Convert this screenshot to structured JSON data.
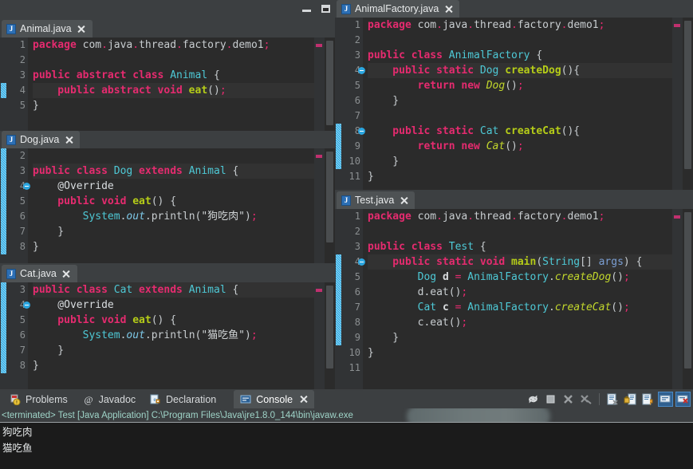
{
  "window": {
    "controls": [
      {
        "name": "minimize",
        "glyph": "minimize-icon"
      },
      {
        "name": "restore",
        "glyph": "restore-icon"
      }
    ]
  },
  "theme": {
    "editor_bg": "#2b2b2b",
    "panel_bg": "#3c3f41",
    "tab_active_bg": "#4e5254",
    "gutter_bg": "#313335",
    "keyword": "#e52b6f",
    "type": "#4ec9d6",
    "method_decl": "#b5cc18",
    "method_call": "#c3d82c",
    "plain": "#c8cdd0",
    "change_marker": "#2ba6e0",
    "console_text": "#e3e6e7",
    "console_info": "#9fd4c8"
  },
  "editors": [
    {
      "id": "animal",
      "tab": {
        "label": "Animal.java",
        "icon": "java-file-icon",
        "close": "close-icon",
        "active": true
      },
      "first_line": 1,
      "highlight_row": 4,
      "change_from": 4,
      "change_to": 4,
      "fold_rows": [],
      "lines": [
        {
          "n": 1,
          "tokens": [
            {
              "t": "package",
              "c": "k"
            },
            {
              "t": " com",
              "c": "pl"
            },
            {
              "t": ".",
              "c": "dot"
            },
            {
              "t": "java",
              "c": "pl"
            },
            {
              "t": ".",
              "c": "dot"
            },
            {
              "t": "thread",
              "c": "pl"
            },
            {
              "t": ".",
              "c": "dot"
            },
            {
              "t": "factory",
              "c": "pl"
            },
            {
              "t": ".",
              "c": "dot"
            },
            {
              "t": "demo1",
              "c": "pl"
            },
            {
              "t": ";",
              "c": "sc"
            }
          ]
        },
        {
          "n": 2,
          "tokens": []
        },
        {
          "n": 3,
          "tokens": [
            {
              "t": "public abstract class ",
              "c": "k"
            },
            {
              "t": "Animal",
              "c": "ty"
            },
            {
              "t": " {",
              "c": "pl"
            }
          ]
        },
        {
          "n": 4,
          "tokens": [
            {
              "t": "    public abstract void ",
              "c": "k"
            },
            {
              "t": "eat",
              "c": "mth"
            },
            {
              "t": "()",
              "c": "pl"
            },
            {
              "t": ";",
              "c": "sc"
            }
          ]
        },
        {
          "n": 5,
          "tokens": [
            {
              "t": "}",
              "c": "pl"
            }
          ]
        }
      ]
    },
    {
      "id": "dog",
      "tab": {
        "label": "Dog.java",
        "icon": "java-file-icon",
        "close": "close-icon",
        "active": true
      },
      "first_line": 2,
      "highlight_row": 3,
      "change_from": 2,
      "change_to": 8,
      "fold_rows": [
        4
      ],
      "lines": [
        {
          "n": 2,
          "tokens": []
        },
        {
          "n": 3,
          "tokens": [
            {
              "t": "public class ",
              "c": "k"
            },
            {
              "t": "Dog",
              "c": "ty"
            },
            {
              "t": " extends ",
              "c": "k"
            },
            {
              "t": "Animal",
              "c": "ty"
            },
            {
              "t": " {",
              "c": "pl"
            }
          ]
        },
        {
          "n": 4,
          "tokens": [
            {
              "t": "    @Override",
              "c": "ann"
            }
          ]
        },
        {
          "n": 5,
          "tokens": [
            {
              "t": "    public void ",
              "c": "k"
            },
            {
              "t": "eat",
              "c": "mth"
            },
            {
              "t": "() {",
              "c": "pl"
            }
          ]
        },
        {
          "n": 6,
          "tokens": [
            {
              "t": "        ",
              "c": "pl"
            },
            {
              "t": "System",
              "c": "ty"
            },
            {
              "t": ".",
              "c": "pl"
            },
            {
              "t": "out",
              "c": "fld"
            },
            {
              "t": ".",
              "c": "pl"
            },
            {
              "t": "println",
              "c": "pl"
            },
            {
              "t": "(",
              "c": "pl"
            },
            {
              "t": "\"狗吃肉\"",
              "c": "str"
            },
            {
              "t": ")",
              "c": "pl"
            },
            {
              "t": ";",
              "c": "sc"
            }
          ]
        },
        {
          "n": 7,
          "tokens": [
            {
              "t": "    }",
              "c": "pl"
            }
          ]
        },
        {
          "n": 8,
          "tokens": [
            {
              "t": "}",
              "c": "pl"
            }
          ]
        }
      ]
    },
    {
      "id": "cat",
      "tab": {
        "label": "Cat.java",
        "icon": "java-file-icon",
        "close": "close-icon",
        "active": true
      },
      "first_line": 3,
      "highlight_row": 3,
      "change_from": 3,
      "change_to": 8,
      "fold_rows": [
        4
      ],
      "lines": [
        {
          "n": 3,
          "tokens": [
            {
              "t": "public class ",
              "c": "k"
            },
            {
              "t": "Cat",
              "c": "ty"
            },
            {
              "t": " extends ",
              "c": "k"
            },
            {
              "t": "Animal",
              "c": "ty"
            },
            {
              "t": " {",
              "c": "pl"
            }
          ]
        },
        {
          "n": 4,
          "tokens": [
            {
              "t": "    @Override",
              "c": "ann"
            }
          ]
        },
        {
          "n": 5,
          "tokens": [
            {
              "t": "    public void ",
              "c": "k"
            },
            {
              "t": "eat",
              "c": "mth"
            },
            {
              "t": "() {",
              "c": "pl"
            }
          ]
        },
        {
          "n": 6,
          "tokens": [
            {
              "t": "        ",
              "c": "pl"
            },
            {
              "t": "System",
              "c": "ty"
            },
            {
              "t": ".",
              "c": "pl"
            },
            {
              "t": "out",
              "c": "fld"
            },
            {
              "t": ".",
              "c": "pl"
            },
            {
              "t": "println",
              "c": "pl"
            },
            {
              "t": "(",
              "c": "pl"
            },
            {
              "t": "\"猫吃鱼\"",
              "c": "str"
            },
            {
              "t": ")",
              "c": "pl"
            },
            {
              "t": ";",
              "c": "sc"
            }
          ]
        },
        {
          "n": 7,
          "tokens": [
            {
              "t": "    }",
              "c": "pl"
            }
          ]
        },
        {
          "n": 8,
          "tokens": [
            {
              "t": "}",
              "c": "pl"
            }
          ]
        }
      ]
    },
    {
      "id": "factory",
      "tab": {
        "label": "AnimalFactory.java",
        "icon": "java-file-icon",
        "close": "close-icon",
        "active": true
      },
      "first_line": 1,
      "highlight_row": 4,
      "change_from": 8,
      "change_to": 10,
      "fold_rows": [
        4,
        8
      ],
      "lines": [
        {
          "n": 1,
          "tokens": [
            {
              "t": "package",
              "c": "k"
            },
            {
              "t": " com",
              "c": "pl"
            },
            {
              "t": ".",
              "c": "dot"
            },
            {
              "t": "java",
              "c": "pl"
            },
            {
              "t": ".",
              "c": "dot"
            },
            {
              "t": "thread",
              "c": "pl"
            },
            {
              "t": ".",
              "c": "dot"
            },
            {
              "t": "factory",
              "c": "pl"
            },
            {
              "t": ".",
              "c": "dot"
            },
            {
              "t": "demo1",
              "c": "pl"
            },
            {
              "t": ";",
              "c": "sc"
            }
          ]
        },
        {
          "n": 2,
          "tokens": []
        },
        {
          "n": 3,
          "tokens": [
            {
              "t": "public class ",
              "c": "k"
            },
            {
              "t": "AnimalFactory",
              "c": "ty"
            },
            {
              "t": " {",
              "c": "pl"
            }
          ]
        },
        {
          "n": 4,
          "tokens": [
            {
              "t": "    public static ",
              "c": "k"
            },
            {
              "t": "Dog",
              "c": "ty"
            },
            {
              "t": " ",
              "c": "pl"
            },
            {
              "t": "createDog",
              "c": "mth"
            },
            {
              "t": "(){",
              "c": "pl"
            }
          ]
        },
        {
          "n": 5,
          "tokens": [
            {
              "t": "        return new ",
              "c": "k"
            },
            {
              "t": "Dog",
              "c": "mthc"
            },
            {
              "t": "()",
              "c": "pl"
            },
            {
              "t": ";",
              "c": "sc"
            }
          ]
        },
        {
          "n": 6,
          "tokens": [
            {
              "t": "    }",
              "c": "pl"
            }
          ]
        },
        {
          "n": 7,
          "tokens": []
        },
        {
          "n": 8,
          "tokens": [
            {
              "t": "    public static ",
              "c": "k"
            },
            {
              "t": "Cat",
              "c": "ty"
            },
            {
              "t": " ",
              "c": "pl"
            },
            {
              "t": "createCat",
              "c": "mth"
            },
            {
              "t": "(){",
              "c": "pl"
            }
          ]
        },
        {
          "n": 9,
          "tokens": [
            {
              "t": "        return new ",
              "c": "k"
            },
            {
              "t": "Cat",
              "c": "mthc"
            },
            {
              "t": "()",
              "c": "pl"
            },
            {
              "t": ";",
              "c": "sc"
            }
          ]
        },
        {
          "n": 10,
          "tokens": [
            {
              "t": "    }",
              "c": "pl"
            }
          ]
        },
        {
          "n": 11,
          "tokens": [
            {
              "t": "}",
              "c": "pl"
            }
          ]
        }
      ]
    },
    {
      "id": "test",
      "tab": {
        "label": "Test.java",
        "icon": "java-file-icon",
        "close": "close-icon",
        "active": true
      },
      "first_line": 1,
      "highlight_row": 4,
      "change_from": 4,
      "change_to": 9,
      "fold_rows": [
        4
      ],
      "lines": [
        {
          "n": 1,
          "tokens": [
            {
              "t": "package",
              "c": "k"
            },
            {
              "t": " com",
              "c": "pl"
            },
            {
              "t": ".",
              "c": "dot"
            },
            {
              "t": "java",
              "c": "pl"
            },
            {
              "t": ".",
              "c": "dot"
            },
            {
              "t": "thread",
              "c": "pl"
            },
            {
              "t": ".",
              "c": "dot"
            },
            {
              "t": "factory",
              "c": "pl"
            },
            {
              "t": ".",
              "c": "dot"
            },
            {
              "t": "demo1",
              "c": "pl"
            },
            {
              "t": ";",
              "c": "sc"
            }
          ]
        },
        {
          "n": 2,
          "tokens": []
        },
        {
          "n": 3,
          "tokens": [
            {
              "t": "public class ",
              "c": "k"
            },
            {
              "t": "Test",
              "c": "ty"
            },
            {
              "t": " {",
              "c": "pl"
            }
          ]
        },
        {
          "n": 4,
          "tokens": [
            {
              "t": "    public static void ",
              "c": "k"
            },
            {
              "t": "main",
              "c": "mth"
            },
            {
              "t": "(",
              "c": "pl"
            },
            {
              "t": "String",
              "c": "ty"
            },
            {
              "t": "[] ",
              "c": "pl"
            },
            {
              "t": "args",
              "c": "prm"
            },
            {
              "t": ") {",
              "c": "pl"
            }
          ]
        },
        {
          "n": 5,
          "tokens": [
            {
              "t": "        ",
              "c": "pl"
            },
            {
              "t": "Dog",
              "c": "ty"
            },
            {
              "t": " ",
              "c": "pl"
            },
            {
              "t": "d",
              "c": "var"
            },
            {
              "t": " ",
              "c": "pl"
            },
            {
              "t": "=",
              "c": "sc"
            },
            {
              "t": " ",
              "c": "pl"
            },
            {
              "t": "AnimalFactory",
              "c": "ty"
            },
            {
              "t": ".",
              "c": "pl"
            },
            {
              "t": "createDog",
              "c": "mthc"
            },
            {
              "t": "()",
              "c": "pl"
            },
            {
              "t": ";",
              "c": "sc"
            }
          ]
        },
        {
          "n": 6,
          "tokens": [
            {
              "t": "        ",
              "c": "pl"
            },
            {
              "t": "d",
              "c": "pl"
            },
            {
              "t": ".",
              "c": "pl"
            },
            {
              "t": "eat",
              "c": "pl"
            },
            {
              "t": "()",
              "c": "pl"
            },
            {
              "t": ";",
              "c": "sc"
            }
          ]
        },
        {
          "n": 7,
          "tokens": [
            {
              "t": "        ",
              "c": "pl"
            },
            {
              "t": "Cat",
              "c": "ty"
            },
            {
              "t": " ",
              "c": "pl"
            },
            {
              "t": "c",
              "c": "var"
            },
            {
              "t": " ",
              "c": "pl"
            },
            {
              "t": "=",
              "c": "sc"
            },
            {
              "t": " ",
              "c": "pl"
            },
            {
              "t": "AnimalFactory",
              "c": "ty"
            },
            {
              "t": ".",
              "c": "pl"
            },
            {
              "t": "createCat",
              "c": "mthc"
            },
            {
              "t": "()",
              "c": "pl"
            },
            {
              "t": ";",
              "c": "sc"
            }
          ]
        },
        {
          "n": 8,
          "tokens": [
            {
              "t": "        ",
              "c": "pl"
            },
            {
              "t": "c",
              "c": "pl"
            },
            {
              "t": ".",
              "c": "pl"
            },
            {
              "t": "eat",
              "c": "pl"
            },
            {
              "t": "()",
              "c": "pl"
            },
            {
              "t": ";",
              "c": "sc"
            }
          ]
        },
        {
          "n": 9,
          "tokens": [
            {
              "t": "    }",
              "c": "pl"
            }
          ]
        },
        {
          "n": 10,
          "tokens": [
            {
              "t": "}",
              "c": "pl"
            }
          ]
        },
        {
          "n": 11,
          "tokens": []
        }
      ]
    }
  ],
  "console": {
    "tabs": [
      {
        "label": "Problems",
        "icon": "problems-icon",
        "active": false,
        "closeable": false
      },
      {
        "label": "Javadoc",
        "icon": "javadoc-at-icon",
        "active": false,
        "closeable": false
      },
      {
        "label": "Declaration",
        "icon": "declaration-icon",
        "active": false,
        "closeable": false
      },
      {
        "label": "Console",
        "icon": "console-icon",
        "active": true,
        "closeable": true,
        "close": "close-icon"
      }
    ],
    "toolbar": [
      {
        "name": "relaunch-icon",
        "selected": false
      },
      {
        "name": "terminate-icon",
        "selected": false
      },
      {
        "name": "remove-launch-icon",
        "selected": false
      },
      {
        "name": "remove-all-terminated-icon",
        "selected": false
      },
      {
        "name": "separator",
        "selected": false
      },
      {
        "name": "clear-console-icon",
        "selected": false
      },
      {
        "name": "scroll-lock-icon",
        "selected": false
      },
      {
        "name": "word-wrap-icon",
        "selected": false
      },
      {
        "name": "show-console-on-output-icon",
        "selected": true
      },
      {
        "name": "show-console-on-error-icon",
        "selected": true
      }
    ],
    "status_line": "<terminated> Test [Java Application] C:\\Program Files\\Java\\jre1.8.0_144\\bin\\javaw.exe",
    "output": [
      "狗吃肉",
      "猫吃鱼"
    ]
  }
}
